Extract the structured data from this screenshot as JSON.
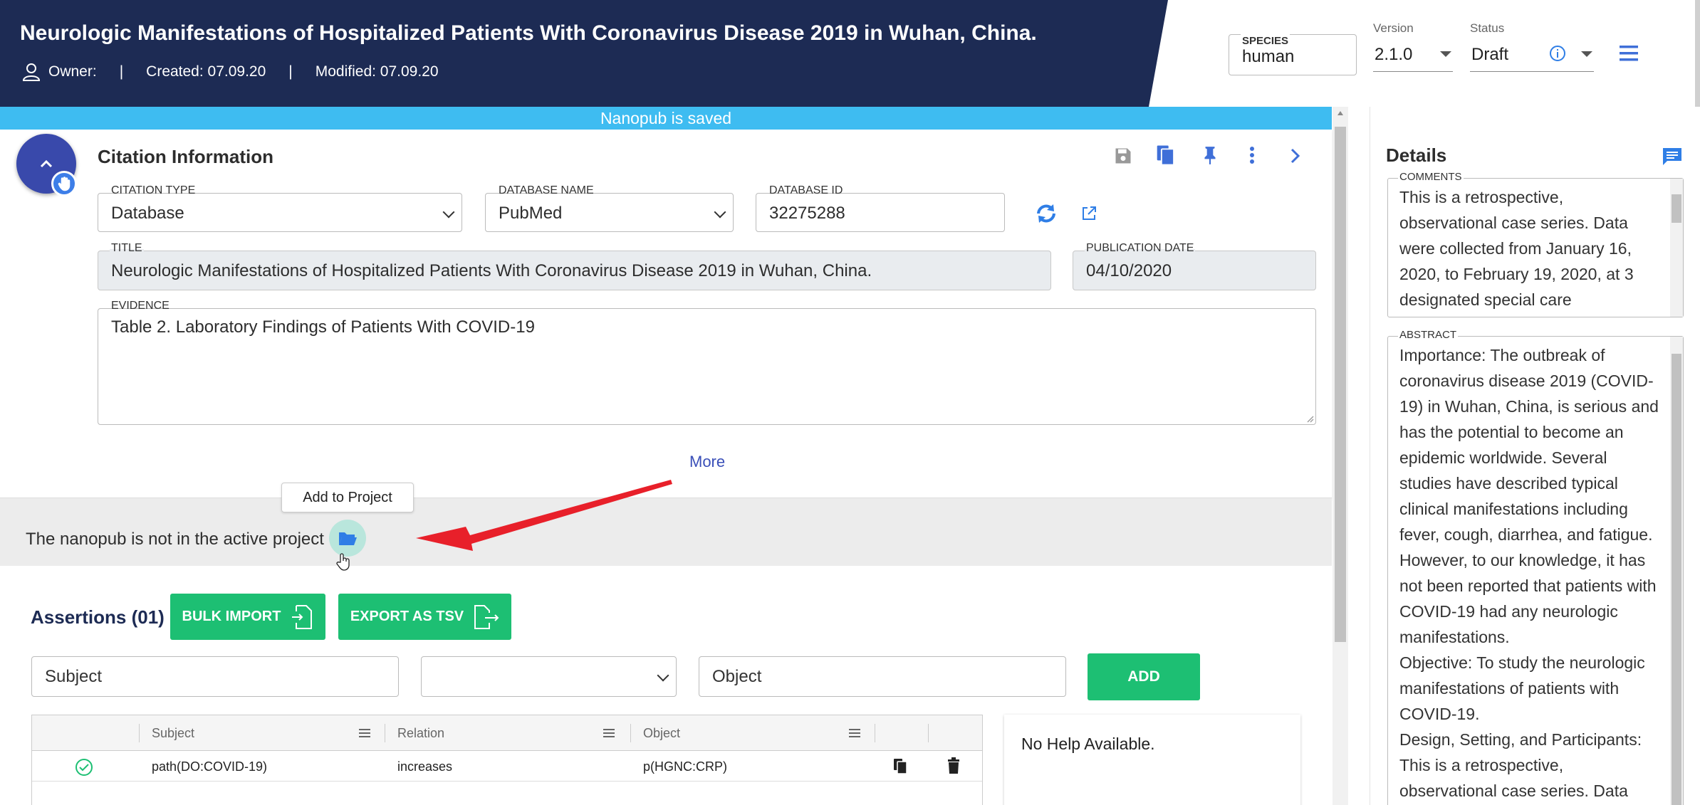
{
  "header": {
    "title": "Neurologic Manifestations of Hospitalized Patients With Coronavirus Disease 2019 in Wuhan, China.",
    "owner_label": "Owner:",
    "separator": "|",
    "created": "Created: 07.09.20",
    "modified": "Modified: 07.09.20",
    "species_label": "SPECIES",
    "species_value": "human",
    "version_label": "Version",
    "version_value": "2.1.0",
    "status_label": "Status",
    "status_value": "Draft"
  },
  "banner": {
    "text": "Nanopub is saved"
  },
  "citation": {
    "title": "Citation Information",
    "citation_type_label": "CITATION TYPE",
    "citation_type_value": "Database",
    "database_name_label": "DATABASE NAME",
    "database_name_value": "PubMed",
    "database_id_label": "DATABASE ID",
    "database_id_value": "32275288",
    "title_label": "TITLE",
    "title_value": "Neurologic Manifestations of Hospitalized Patients With Coronavirus Disease 2019 in Wuhan, China.",
    "pubdate_label": "PUBLICATION DATE",
    "pubdate_value": "04/10/2020",
    "evidence_label": "EVIDENCE",
    "evidence_value": "Table 2. Laboratory Findings of Patients With COVID-19",
    "more_link": "More"
  },
  "project": {
    "text": "The nanopub is not in the active project",
    "tooltip": "Add to Project"
  },
  "assertions": {
    "title": "Assertions (01)",
    "bulk_import": "BULK IMPORT",
    "export_tsv": "EXPORT AS TSV",
    "subject_placeholder": "Subject",
    "relation_value": "",
    "object_placeholder": "Object",
    "add_button": "ADD",
    "columns": [
      "Subject",
      "Relation",
      "Object"
    ],
    "rows": [
      {
        "subject": "path(DO:COVID-19)",
        "relation": "increases",
        "object": "p(HGNC:CRP)"
      }
    ],
    "help_text": "No Help Available."
  },
  "details": {
    "title": "Details",
    "comments_label": "COMMENTS",
    "comments_text": "This is a retrospective, observational case series. Data were collected from January 16, 2020, to February 19, 2020, at 3 designated special care",
    "abstract_label": "ABSTRACT",
    "abstract_text": "Importance: The outbreak of coronavirus disease 2019 (COVID-19) in Wuhan, China, is serious and has the potential to become an epidemic worldwide. Several studies have described typical clinical manifestations including fever, cough, diarrhea, and fatigue. However, to our knowledge, it has not been reported that patients with COVID-19 had any neurologic manifestations.\nObjective: To study the neurologic manifestations of patients with COVID-19.\nDesign, Setting, and Participants: This is a retrospective, observational case series. Data"
  },
  "colors": {
    "header_bg": "#1d2b54",
    "banner": "#3ebcf1",
    "green": "#1dbf73",
    "fab": "#3949ab",
    "arrow": "#e8202a"
  }
}
